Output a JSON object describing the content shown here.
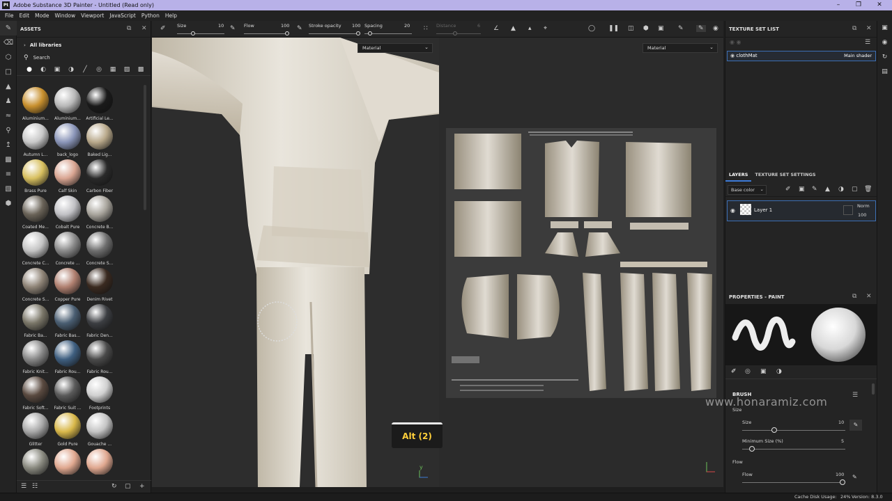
{
  "window": {
    "title": "Adobe Substance 3D Painter - Untitled (Read only)",
    "app_icon": "Pt"
  },
  "menu": [
    "File",
    "Edit",
    "Mode",
    "Window",
    "Viewport",
    "JavaScript",
    "Python",
    "Help"
  ],
  "assets": {
    "title": "ASSETS",
    "library": "All libraries",
    "search_placeholder": "Search",
    "materials": [
      {
        "label": "Aluminium...",
        "color": "#c8902e"
      },
      {
        "label": "Aluminium...",
        "color": "#b8b8b8"
      },
      {
        "label": "Artificial Le...",
        "color": "#1a1a1a"
      },
      {
        "label": "Autumn L...",
        "color": "#c8c8c8"
      },
      {
        "label": "back_logo",
        "color": "#8a95b8"
      },
      {
        "label": "Baked Lig...",
        "color": "#b8a88a"
      },
      {
        "label": "Brass Pure",
        "color": "#d8c060"
      },
      {
        "label": "Calf Skin",
        "color": "#d9a592"
      },
      {
        "label": "Carbon Fiber",
        "color": "#2a2a2a"
      },
      {
        "label": "Coated Me...",
        "color": "#6a6358"
      },
      {
        "label": "Cobalt Pure",
        "color": "#c0c0c4"
      },
      {
        "label": "Concrete B...",
        "color": "#a8a49c"
      },
      {
        "label": "Concrete C...",
        "color": "#c4c4c4"
      },
      {
        "label": "Concrete ...",
        "color": "#8a8a8a"
      },
      {
        "label": "Concrete S...",
        "color": "#6e6e6e"
      },
      {
        "label": "Concrete S...",
        "color": "#8f8477"
      },
      {
        "label": "Copper Pure",
        "color": "#b08070"
      },
      {
        "label": "Denim Rivet",
        "color": "#3a2a20"
      },
      {
        "label": "Fabric Ba...",
        "color": "#7a7668"
      },
      {
        "label": "Fabric Bas...",
        "color": "#4a5e72"
      },
      {
        "label": "Fabric Den...",
        "color": "#3c3e42"
      },
      {
        "label": "Fabric Knit...",
        "color": "#888888"
      },
      {
        "label": "Fabric Rou...",
        "color": "#3f5f80"
      },
      {
        "label": "Fabric Rou...",
        "color": "#4a4a4a"
      },
      {
        "label": "Fabric Soft...",
        "color": "#5a4a40"
      },
      {
        "label": "Fabric Suit ...",
        "color": "#5a5a5a"
      },
      {
        "label": "Footprints",
        "color": "#d0d0d0"
      },
      {
        "label": "Glitter",
        "color": "#a8a8a8"
      },
      {
        "label": "Gold Pure",
        "color": "#d9b84a"
      },
      {
        "label": "Gouache ...",
        "color": "#c4c4c4"
      },
      {
        "label": "",
        "color": "#8a8a80"
      },
      {
        "label": "",
        "color": "#e0a890"
      },
      {
        "label": "",
        "color": "#e0a890"
      }
    ]
  },
  "toolbar": {
    "size_label": "Size",
    "size_value": "10",
    "flow_label": "Flow",
    "flow_value": "100",
    "stroke_opacity_label": "Stroke opacity",
    "stroke_opacity_value": "100",
    "spacing_label": "Spacing",
    "spacing_value": "20",
    "distance_label": "Distance",
    "distance_value": "6"
  },
  "viewport": {
    "left_channel": "Material",
    "right_channel": "Material",
    "shortcut_badge": "Alt (2)"
  },
  "texture_set_list": {
    "title": "TEXTURE SET LIST",
    "set_name": "clothMat",
    "shader": "Main shader"
  },
  "layers": {
    "tab_layers": "LAYERS",
    "tab_settings": "TEXTURE SET SETTINGS",
    "channel": "Base color",
    "layer_name": "Layer 1",
    "blend": "Norm",
    "opacity": "100"
  },
  "properties": {
    "title": "PROPERTIES - PAINT",
    "section": "BRUSH",
    "size_group": "Size",
    "size_label": "Size",
    "size_value": "10",
    "min_size_label": "Minimum Size (%)",
    "min_size_value": "5",
    "flow_group": "Flow",
    "flow_label": "Flow",
    "flow_value": "100"
  },
  "status": {
    "cache_label": "Cache Disk Usage:",
    "cache_value": "24%",
    "version": "Version: 8.3.0"
  },
  "watermark": "www.honaramiz.com"
}
